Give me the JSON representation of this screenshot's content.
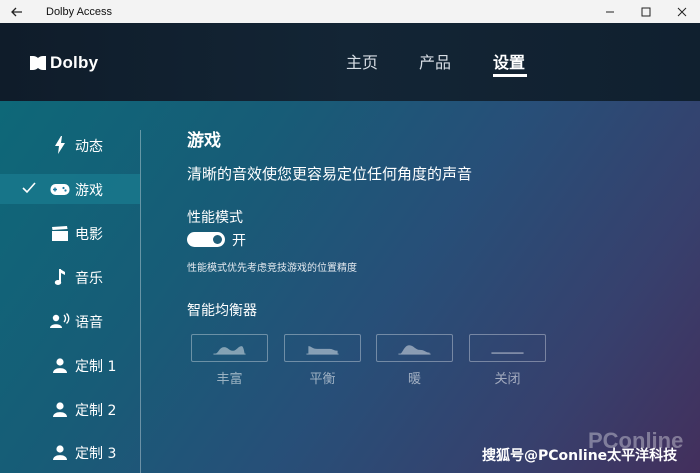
{
  "window": {
    "title": "Dolby Access"
  },
  "header": {
    "logo_text": "Dolby",
    "nav": [
      {
        "label": "主页",
        "active": false
      },
      {
        "label": "产品",
        "active": false
      },
      {
        "label": "设置",
        "active": true
      }
    ]
  },
  "sidebar": {
    "items": [
      {
        "label": "动态",
        "icon": "lightning-icon",
        "active": false
      },
      {
        "label": "游戏",
        "icon": "gamepad-icon",
        "active": true
      },
      {
        "label": "电影",
        "icon": "clapperboard-icon",
        "active": false
      },
      {
        "label": "音乐",
        "icon": "music-note-icon",
        "active": false
      },
      {
        "label": "语音",
        "icon": "voice-icon",
        "active": false
      },
      {
        "label": "定制 1",
        "icon": "person-icon",
        "active": false
      },
      {
        "label": "定制 2",
        "icon": "person-icon",
        "active": false
      },
      {
        "label": "定制 3",
        "icon": "person-icon",
        "active": false
      }
    ]
  },
  "main": {
    "title": "游戏",
    "subtitle": "清晰的音效使您更容易定位任何角度的声音",
    "performance": {
      "title": "性能模式",
      "toggle_on": true,
      "toggle_label": "开",
      "helper": "性能模式优先考虑竞技游戏的位置精度"
    },
    "equalizer": {
      "title": "智能均衡器",
      "options": [
        {
          "label": "丰富",
          "icon": "eq-rich-icon"
        },
        {
          "label": "平衡",
          "icon": "eq-balanced-icon"
        },
        {
          "label": "暖",
          "icon": "eq-warm-icon"
        },
        {
          "label": "关闭",
          "icon": "eq-off-icon"
        }
      ]
    }
  },
  "watermark": {
    "brand": "PConline",
    "text": "搜狐号@PConline太平洋科技"
  },
  "colors": {
    "accent": "#1978a0",
    "header_bg": "#0f1c2a"
  }
}
